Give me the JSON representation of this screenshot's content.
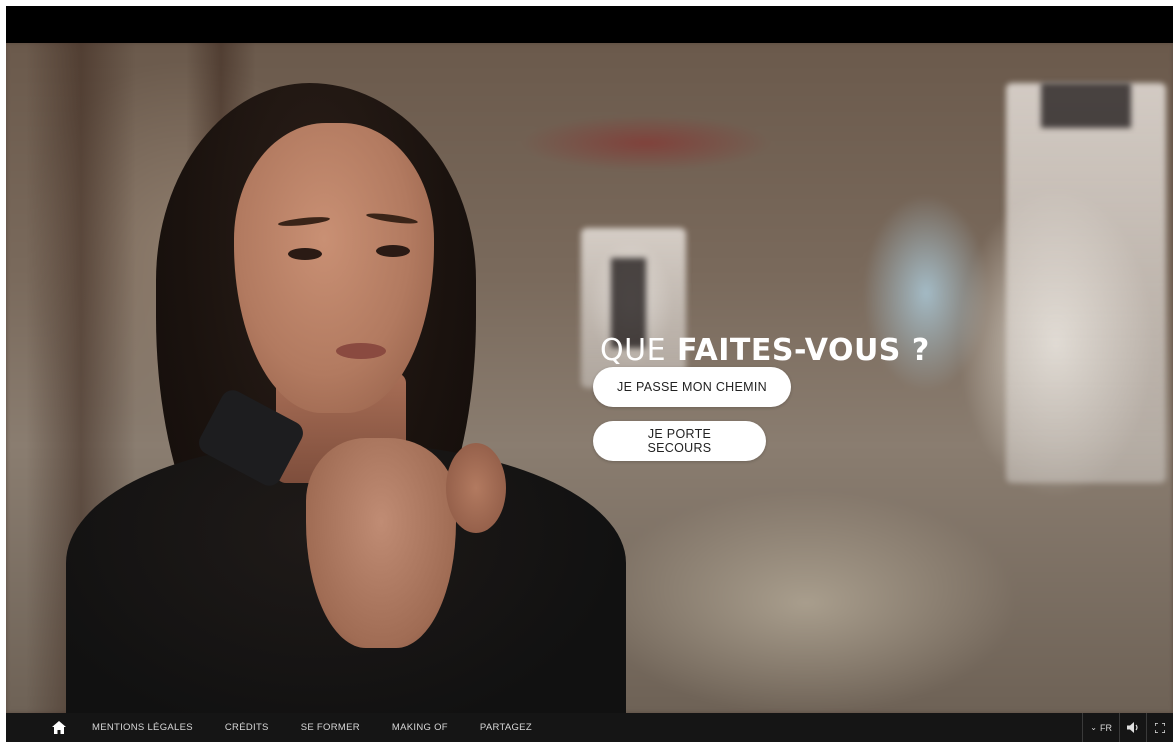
{
  "scene": {
    "question_prefix": "QUE",
    "question_emphasis": "FAITES-VOUS ?",
    "choices": [
      {
        "label": "JE PASSE MON CHEMIN"
      },
      {
        "label": "JE PORTE SECOURS"
      }
    ]
  },
  "footer": {
    "home_icon": "home-icon",
    "links": [
      {
        "label": "MENTIONS LÉGALES"
      },
      {
        "label": "CRÉDITS"
      },
      {
        "label": "SE FORMER"
      },
      {
        "label": "MAKING OF"
      },
      {
        "label": "PARTAGEZ"
      }
    ],
    "language": "FR",
    "sound_icon": "speaker-icon",
    "fullscreen_icon": "fullscreen-icon"
  },
  "colors": {
    "bar_background": "#151515",
    "button_background": "#ffffff",
    "question_text": "#ffffff"
  }
}
